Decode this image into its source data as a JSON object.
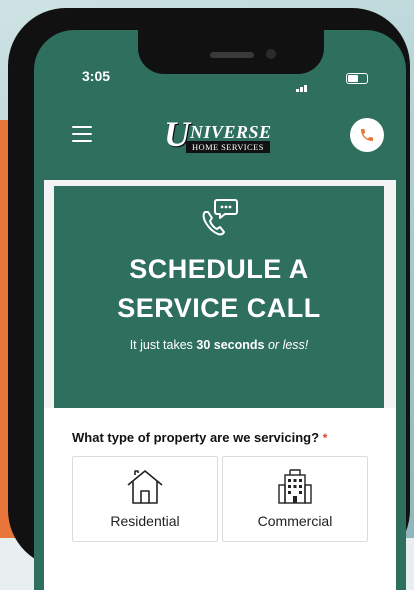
{
  "status": {
    "time": "3:05"
  },
  "header": {
    "logo_initial": "U",
    "logo_rest": "NIVERSE",
    "logo_sub": "HOME SERVICES"
  },
  "hero": {
    "title_line1": "SCHEDULE A",
    "title_line2": "SERVICE CALL",
    "sub_prefix": "It just takes ",
    "sub_bold": "30 seconds",
    "sub_italic": "or less!"
  },
  "form": {
    "question": "What type of property are we servicing?",
    "required_mark": "*",
    "options": [
      {
        "label": "Residential",
        "icon": "house-icon"
      },
      {
        "label": "Commercial",
        "icon": "building-icon"
      }
    ]
  },
  "colors": {
    "brand_green": "#2f6f5d",
    "accent_orange": "#e8753a",
    "required_red": "#d9442b"
  }
}
